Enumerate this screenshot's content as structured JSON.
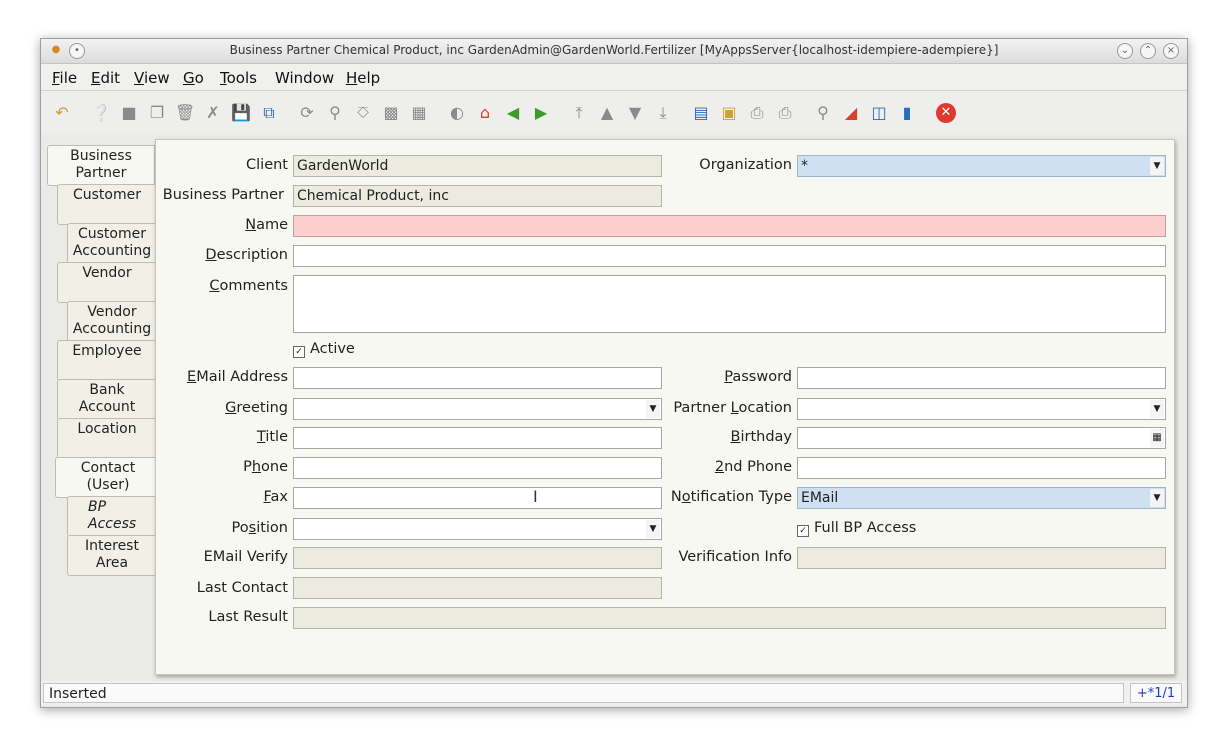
{
  "window": {
    "title": "Business Partner  Chemical Product, inc  GardenAdmin@GardenWorld.Fertilizer [MyAppsServer{localhost-idempiere-adempiere}]"
  },
  "menu": [
    "File",
    "Edit",
    "View",
    "Go",
    "Tools",
    "Window",
    "Help"
  ],
  "tabs": [
    {
      "line1": "Business",
      "line2": "Partner"
    },
    {
      "line1": "Customer",
      "line2": ""
    },
    {
      "line1": "Customer",
      "line2": "Accounting"
    },
    {
      "line1": "Vendor",
      "line2": ""
    },
    {
      "line1": "Vendor",
      "line2": "Accounting"
    },
    {
      "line1": "Employee",
      "line2": ""
    },
    {
      "line1": "Bank",
      "line2": "Account"
    },
    {
      "line1": "Location",
      "line2": ""
    },
    {
      "line1": "Contact",
      "line2": "(User)"
    },
    {
      "line1": "BP",
      "line2": "Access"
    },
    {
      "line1": "Interest",
      "line2": "Area"
    }
  ],
  "form": {
    "client_label": "Client",
    "client_value": "GardenWorld",
    "org_label": "Organization",
    "org_value": "*",
    "bp_label": "Business Partner",
    "bp_value": "Chemical Product, inc",
    "name_label": "Name",
    "name_value": "",
    "desc_label": "Description",
    "desc_value": "",
    "comments_label": "Comments",
    "comments_value": "",
    "active_label": "Active",
    "active_checked": true,
    "email_label": "EMail Address",
    "email_value": "",
    "password_label": "Password",
    "password_value": "",
    "greeting_label": "Greeting",
    "greeting_value": "",
    "partner_location_label": "Partner Location",
    "partner_location_value": "",
    "title_label": "Title",
    "title_value": "",
    "birthday_label": "Birthday",
    "birthday_value": "",
    "phone_label": "Phone",
    "phone_value": "",
    "phone2_label": "2nd Phone",
    "phone2_value": "",
    "fax_label": "Fax",
    "fax_value": "",
    "notification_label": "Notification Type",
    "notification_value": "EMail",
    "position_label": "Position",
    "position_value": "",
    "fullbp_label": "Full BP Access",
    "fullbp_checked": true,
    "email_verify_label": "EMail Verify",
    "email_verify_value": "",
    "verification_label": "Verification Info",
    "verification_value": "",
    "last_contact_label": "Last Contact",
    "last_contact_value": "",
    "last_result_label": "Last Result",
    "last_result_value": ""
  },
  "status": {
    "message": "Inserted",
    "record": "+*1/1"
  }
}
